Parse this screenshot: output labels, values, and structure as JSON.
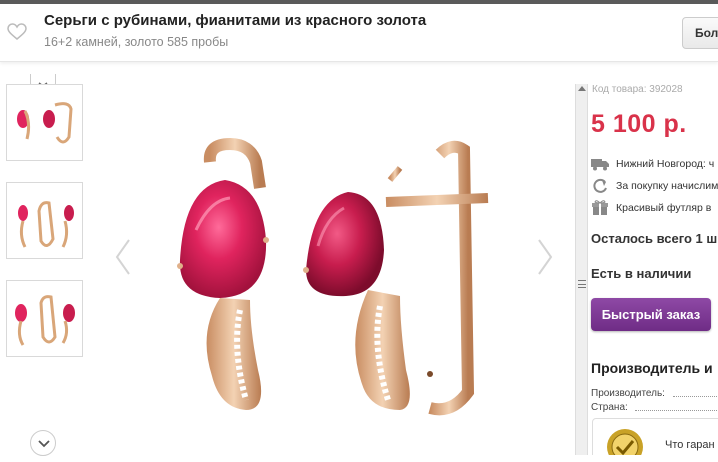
{
  "header": {
    "title": "Серьги с рубинами, фианитами из красного золота",
    "subtitle": "16+2 камней, золото 585 пробы",
    "more_button": "Больше",
    "favorite_icon": "heart-icon"
  },
  "gallery": {
    "thumbnails": [
      "earrings-view-1",
      "earrings-view-2",
      "earrings-view-3"
    ],
    "prev_icon": "chevron-left-icon",
    "next_icon": "chevron-right-icon",
    "scroll_up_icon": "chevron-up-icon",
    "scroll_down_icon": "chevron-down-icon",
    "main_image": "ruby-earrings"
  },
  "product": {
    "sku_label": "Код товара: 392028",
    "price": "5 100 р.",
    "features": [
      {
        "icon": "truck-icon",
        "text": "Нижний Новгород: ч"
      },
      {
        "icon": "refresh-icon",
        "text": "За покупку начислим"
      },
      {
        "icon": "gift-icon",
        "text": "Красивый футляр в"
      }
    ],
    "remaining": "Осталось всего 1 ш",
    "availability": "Есть в наличии",
    "quick_order": "Быстрый заказ"
  },
  "manufacturer": {
    "heading": "Производитель и",
    "rows": [
      "Производитель:",
      "Страна:"
    ]
  },
  "guarantee": {
    "text": "Что гаран",
    "seal_icon": "guarantee-seal-icon"
  },
  "colors": {
    "price": "#d9324a",
    "button": "#7a3592",
    "gold": "#d9a679",
    "ruby": "#e0245e"
  }
}
